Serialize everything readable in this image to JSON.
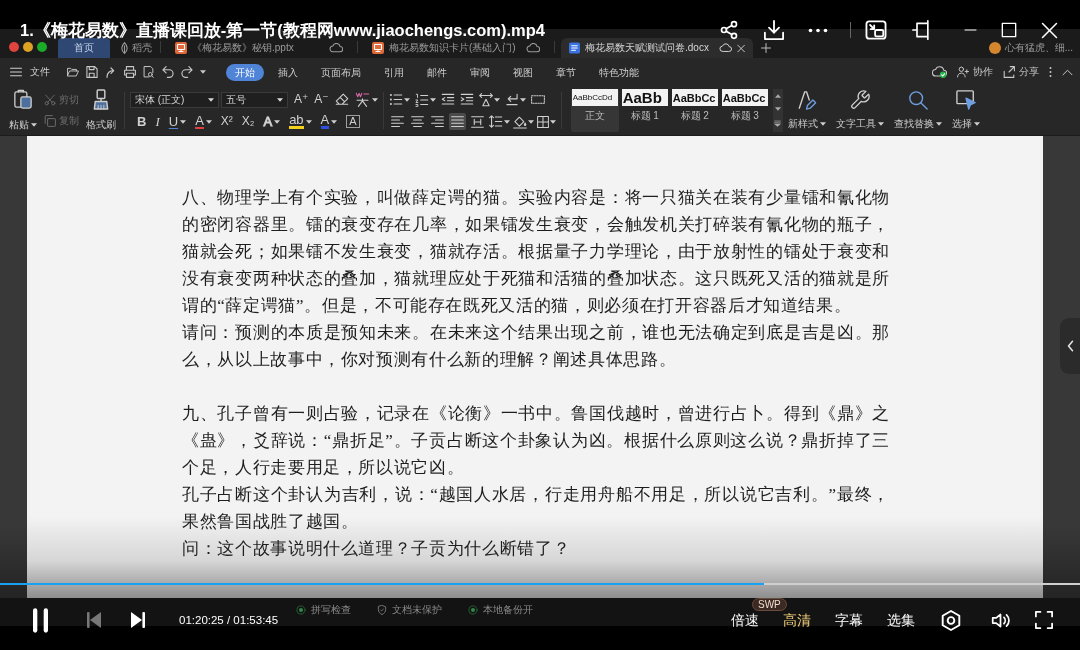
{
  "player_header": {
    "title": "1.《梅花易数》直播课回放-第一节(教程网www.jiaochengs.com).mp4"
  },
  "wps": {
    "tabs": [
      {
        "kind": "home",
        "label": "首页",
        "selected": false
      },
      {
        "kind": "store",
        "label": "稻壳",
        "selected": false
      },
      {
        "kind": "slides",
        "label": "《梅花易数》秘钥.pptx",
        "selected": false
      },
      {
        "kind": "slides",
        "label": "梅花易数知识卡片(基础入门)",
        "selected": false
      },
      {
        "kind": "document",
        "label": "梅花易数天赋测试问卷.docx",
        "selected": true
      }
    ],
    "account": {
      "name": "心有猛虎、细..."
    },
    "menu": {
      "file": "文件",
      "tabs": [
        {
          "label": "开始",
          "selected": true
        },
        {
          "label": "插入",
          "selected": false
        },
        {
          "label": "页面布局",
          "selected": false
        },
        {
          "label": "引用",
          "selected": false
        },
        {
          "label": "邮件",
          "selected": false
        },
        {
          "label": "审阅",
          "selected": false
        },
        {
          "label": "视图",
          "selected": false
        },
        {
          "label": "章节",
          "selected": false
        },
        {
          "label": "特色功能",
          "selected": false
        }
      ],
      "actions": [
        {
          "label": "协作"
        },
        {
          "label": "分享"
        }
      ]
    },
    "ribbon": {
      "clipboard": [
        {
          "kind": "large",
          "label": "粘贴",
          "disabled": false,
          "dropdown": true
        },
        {
          "kind": "small",
          "label": "剪切",
          "disabled": true,
          "dropdown": false
        },
        {
          "kind": "small",
          "label": "复制",
          "disabled": true,
          "dropdown": false
        },
        {
          "kind": "large",
          "label": "格式刷",
          "disabled": false,
          "dropdown": false
        }
      ],
      "font": {
        "name": "宋体 (正文)",
        "size": "五号"
      },
      "font_buttons": [
        {
          "label": "A⁺"
        },
        {
          "label": "A⁻"
        }
      ],
      "format_buttons": [
        {
          "kind": "bold",
          "label": "B",
          "dropdown": false
        },
        {
          "kind": "italic",
          "label": "I",
          "dropdown": false
        },
        {
          "kind": "underline",
          "label": "U",
          "dropdown": true
        },
        {
          "kind": "strike",
          "label": "A",
          "dropdown": true
        },
        {
          "kind": "superscript",
          "label": "X²",
          "dropdown": false
        },
        {
          "kind": "subscript",
          "label": "X₂",
          "dropdown": false
        },
        {
          "kind": "effect",
          "label": "A",
          "dropdown": true
        },
        {
          "kind": "highlight",
          "label": "ab",
          "dropdown": true
        },
        {
          "kind": "color",
          "label": "A",
          "dropdown": true
        },
        {
          "kind": "border",
          "label": "A",
          "dropdown": false
        }
      ],
      "alignment": [
        {
          "selected": false
        },
        {
          "selected": false
        },
        {
          "selected": false
        },
        {
          "selected": true
        },
        {
          "selected": false
        }
      ],
      "styles": [
        {
          "kind": "body",
          "preview": "AaBbCcDd",
          "label": "正文",
          "selected": true
        },
        {
          "kind": "heading1",
          "preview": "AaBb",
          "label": "标题 1",
          "selected": false
        },
        {
          "kind": "heading2",
          "preview": "AaBbCc",
          "label": "标题 2",
          "selected": false
        },
        {
          "kind": "heading3",
          "preview": "AaBbCc",
          "label": "标题 3",
          "selected": false
        }
      ],
      "tools": [
        {
          "label": "新样式"
        },
        {
          "label": "文字工具"
        },
        {
          "label": "查找替换"
        },
        {
          "label": "选择"
        }
      ]
    },
    "document": {
      "sections": [
        {
          "paragraphs": [
            "八、物理学上有个实验，叫做薛定谔的猫。实验内容是：将一只猫关在装有少量镭和氰化物的密闭容器里。镭的衰变存在几率，如果镭发生衰变，会触发机关打碎装有氰化物的瓶子，猫就会死；如果镭不发生衰变，猫就存活。根据量子力学理论，由于放射性的镭处于衰变和没有衰变两种状态的叠加，猫就理应处于死猫和活猫的叠加状态。这只既死又活的猫就是所谓的“薛定谔猫”。但是，不可能存在既死又活的猫，则必须在打开容器后才知道结果。",
            "请问：预测的本质是预知未来。在未来这个结果出现之前，谁也无法确定到底是吉是凶。那么，从以上故事中，你对预测有什么新的理解？阐述具体思路。"
          ]
        },
        {
          "paragraphs": [
            "九、孔子曾有一则占验，记录在《论衡》一书中。鲁国伐越时，曾进行占卜。得到《鼎》之《蛊》，爻辞说：“鼎折足”。子贡占断这个卦象认为凶。根据什么原则这么说？鼎折掉了三个足，人行走要用足，所以说它凶。",
            "孔子占断这个卦认为吉利，说：“越国人水居，行走用舟船不用足，所以说它吉利。”最终，果然鲁国战胜了越国。",
            "问：这个故事说明什么道理？子贡为什么断错了？"
          ]
        }
      ]
    },
    "status_bar": {
      "items": [
        {
          "label": "拼写检查"
        },
        {
          "label": "文档未保护"
        },
        {
          "label": "本地备份开"
        }
      ]
    }
  },
  "player_controls": {
    "progress": {
      "level": 0.707
    },
    "playing": true,
    "previous": {
      "disabled": true
    },
    "time": "01:20:25 / 01:53:45",
    "options": [
      {
        "label": "倍速",
        "selected": false
      },
      {
        "label": "高清",
        "selected": true,
        "badge": "SWP"
      },
      {
        "label": "字幕",
        "selected": false
      },
      {
        "label": "选集",
        "selected": false
      }
    ]
  }
}
